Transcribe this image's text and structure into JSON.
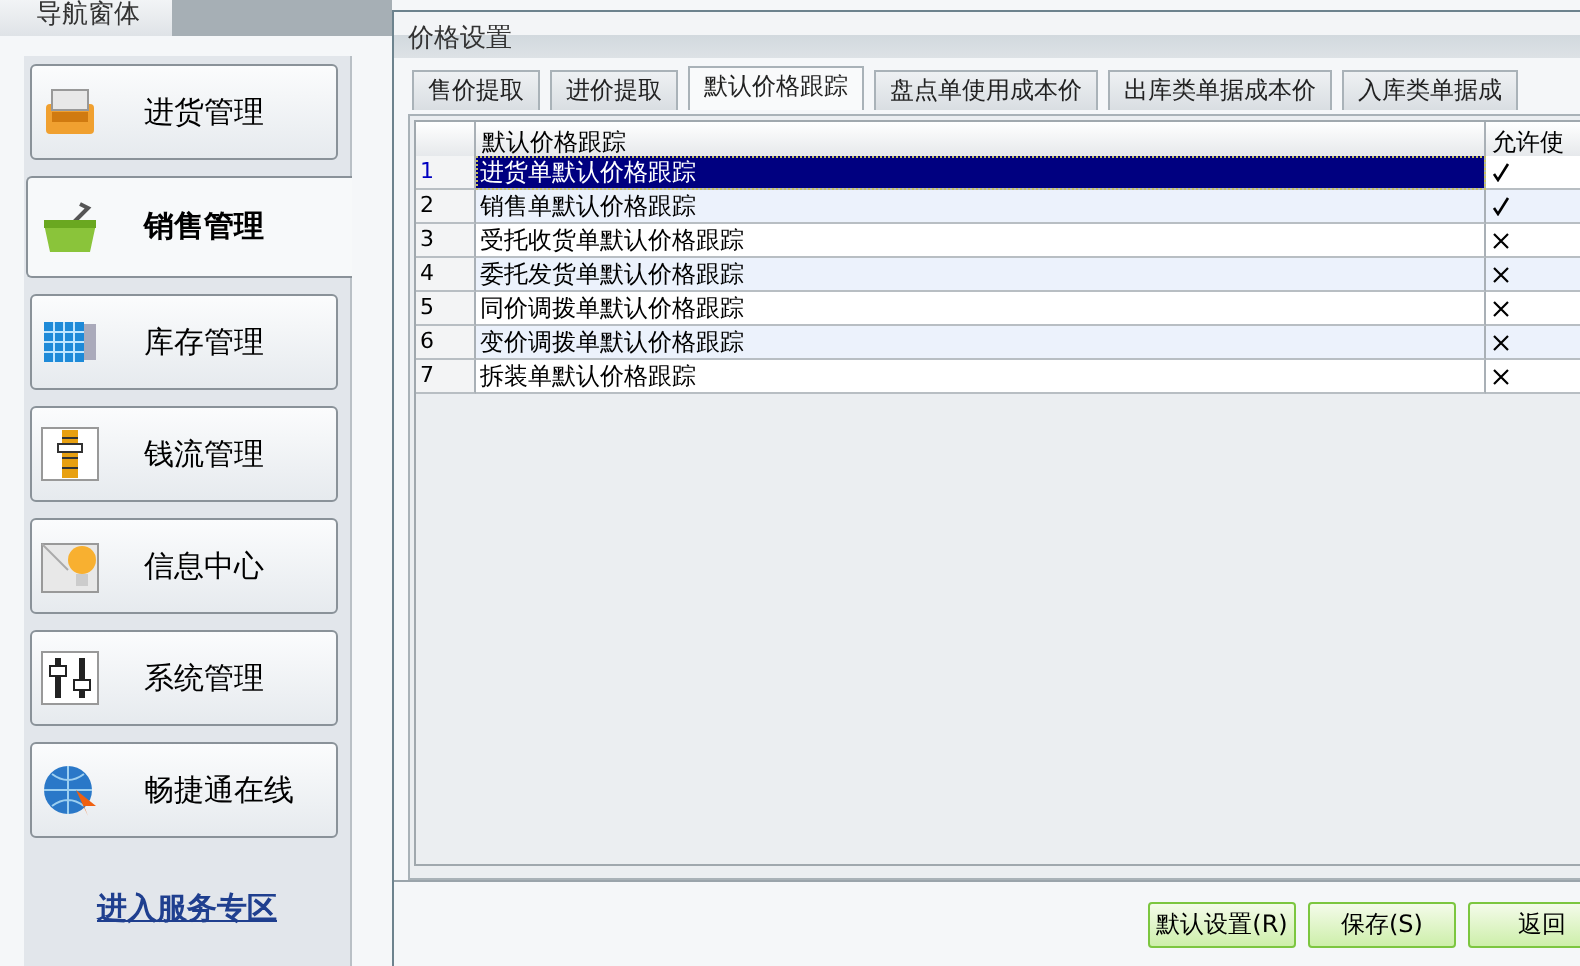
{
  "navigation": {
    "title": "导航窗体",
    "items": [
      {
        "label": "进货管理",
        "selected": false
      },
      {
        "label": "销售管理",
        "selected": true
      },
      {
        "label": "库存管理",
        "selected": false
      },
      {
        "label": "钱流管理",
        "selected": false
      },
      {
        "label": "信息中心",
        "selected": false
      },
      {
        "label": "系统管理",
        "selected": false
      },
      {
        "label": "畅捷通在线",
        "selected": false
      }
    ],
    "link": "进入服务专区"
  },
  "dialog": {
    "title": "价格设置",
    "tabs": [
      {
        "label": "售价提取",
        "selected": false
      },
      {
        "label": "进价提取",
        "selected": false
      },
      {
        "label": "默认价格跟踪",
        "selected": true
      },
      {
        "label": "盘点单使用成本价",
        "selected": false
      },
      {
        "label": "出库类单据成本价",
        "selected": false
      },
      {
        "label": "入库类单据成",
        "selected": false
      }
    ],
    "table": {
      "columns": [
        "默认价格跟踪",
        "允许使"
      ],
      "rows": [
        {
          "index": "1",
          "name": "进货单默认价格跟踪",
          "allowed": true,
          "selected": true
        },
        {
          "index": "2",
          "name": "销售单默认价格跟踪",
          "allowed": true,
          "selected": false
        },
        {
          "index": "3",
          "name": "受托收货单默认价格跟踪",
          "allowed": false,
          "selected": false
        },
        {
          "index": "4",
          "name": "委托发货单默认价格跟踪",
          "allowed": false,
          "selected": false
        },
        {
          "index": "5",
          "name": "同价调拨单默认价格跟踪",
          "allowed": false,
          "selected": false
        },
        {
          "index": "6",
          "name": "变价调拨单默认价格跟踪",
          "allowed": false,
          "selected": false
        },
        {
          "index": "7",
          "name": "拆装单默认价格跟踪",
          "allowed": false,
          "selected": false
        }
      ]
    },
    "buttons": [
      "默认设置(R)",
      "保存(S)",
      "返回"
    ]
  }
}
